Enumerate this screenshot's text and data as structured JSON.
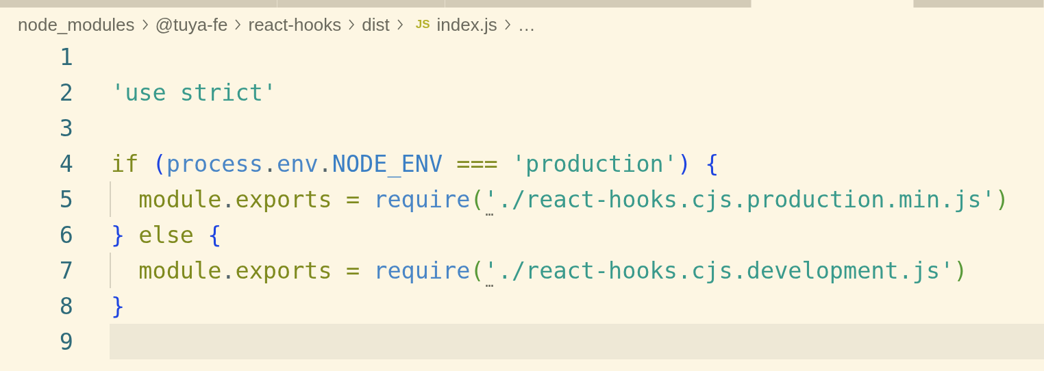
{
  "tabs": [
    {
      "selected": false
    },
    {
      "selected": false
    },
    {
      "selected": false
    },
    {
      "selected": true
    },
    {
      "selected": false
    }
  ],
  "breadcrumb": [
    {
      "label": "node_modules"
    },
    {
      "label": "@tuya-fe"
    },
    {
      "label": "react-hooks"
    },
    {
      "label": "dist"
    },
    {
      "label": "index.js",
      "badge": "JS"
    },
    {
      "label": "…"
    }
  ],
  "lines": [
    {
      "number": "1",
      "guide": false,
      "current": false
    },
    {
      "number": "2",
      "tokens": [
        {
          "kind": "string",
          "text": "'use strict'"
        }
      ],
      "guide": false,
      "current": false
    },
    {
      "number": "3",
      "guide": false,
      "current": false
    },
    {
      "number": "4",
      "tokens": [
        {
          "kind": "keyword",
          "text": "if "
        },
        {
          "kind": "bracket",
          "text": "("
        },
        {
          "kind": "variable",
          "text": "process"
        },
        {
          "kind": "punct",
          "text": "."
        },
        {
          "kind": "variable",
          "text": "env"
        },
        {
          "kind": "punct",
          "text": "."
        },
        {
          "kind": "constant",
          "text": "NODE_ENV"
        },
        {
          "kind": "operator",
          "text": " === "
        },
        {
          "kind": "string",
          "text": "'production'"
        },
        {
          "kind": "bracket",
          "text": ") {"
        }
      ],
      "guide": false,
      "current": false
    },
    {
      "number": "5",
      "tokens": [
        {
          "kind": "keyword",
          "text": "  module"
        },
        {
          "kind": "punct",
          "text": "."
        },
        {
          "kind": "keyword",
          "text": "exports"
        },
        {
          "kind": "operator",
          "text": " = "
        },
        {
          "kind": "variable",
          "text": "require"
        },
        {
          "kind": "paren",
          "text": "("
        },
        {
          "kind": "string",
          "text": "'./react-hooks.cjs.production.min.js'",
          "hint": "…"
        },
        {
          "kind": "paren",
          "text": ")"
        }
      ],
      "guide": true,
      "current": false
    },
    {
      "number": "6",
      "tokens": [
        {
          "kind": "bracket",
          "text": "}"
        },
        {
          "kind": "keyword",
          "text": " else "
        },
        {
          "kind": "bracket",
          "text": "{"
        }
      ],
      "guide": false,
      "current": false
    },
    {
      "number": "7",
      "tokens": [
        {
          "kind": "keyword",
          "text": "  module"
        },
        {
          "kind": "punct",
          "text": "."
        },
        {
          "kind": "keyword",
          "text": "exports"
        },
        {
          "kind": "operator",
          "text": " = "
        },
        {
          "kind": "variable",
          "text": "require"
        },
        {
          "kind": "paren",
          "text": "("
        },
        {
          "kind": "string",
          "text": "'./react-hooks.cjs.development.js'",
          "hint": "…"
        },
        {
          "kind": "paren",
          "text": ")"
        }
      ],
      "guide": true,
      "current": false
    },
    {
      "number": "8",
      "tokens": [
        {
          "kind": "bracket",
          "text": "}"
        }
      ],
      "guide": false,
      "current": false
    },
    {
      "number": "9",
      "guide": false,
      "current": true
    }
  ]
}
